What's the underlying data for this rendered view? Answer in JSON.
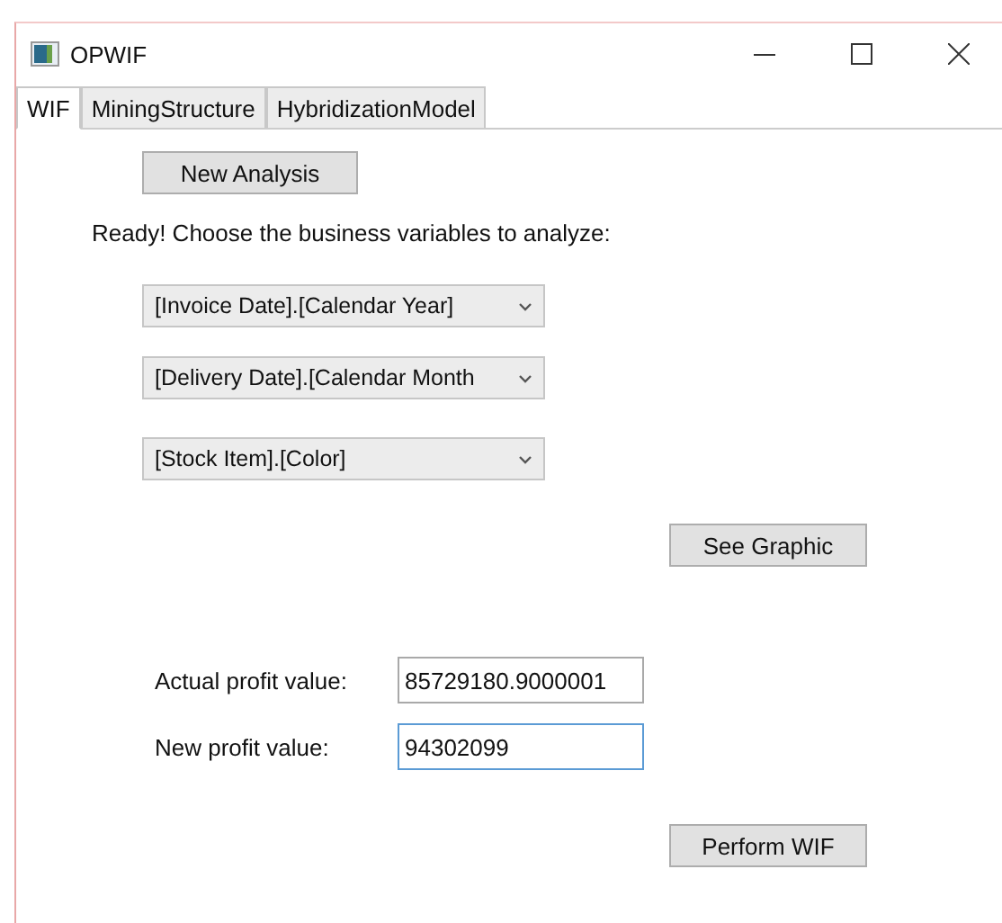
{
  "window": {
    "title": "OPWIF"
  },
  "tabs": [
    {
      "label": "WIF",
      "selected": true
    },
    {
      "label": "MiningStructure",
      "selected": false
    },
    {
      "label": "HybridizationModel",
      "selected": false
    }
  ],
  "new_analysis_button": "New Analysis",
  "status_text": "Ready! Choose the business variables to analyze:",
  "dropdowns": [
    {
      "value": "[Invoice Date].[Calendar Year]"
    },
    {
      "value": "[Delivery Date].[Calendar Month"
    },
    {
      "value": "[Stock Item].[Color]"
    }
  ],
  "see_graphic_button": "See Graphic",
  "fields": [
    {
      "label": "Actual profit value:",
      "value": "85729180.9000001",
      "focused": false
    },
    {
      "label": "New profit value:",
      "value": "94302099",
      "focused": true
    }
  ],
  "perform_button": "Perform WIF"
}
